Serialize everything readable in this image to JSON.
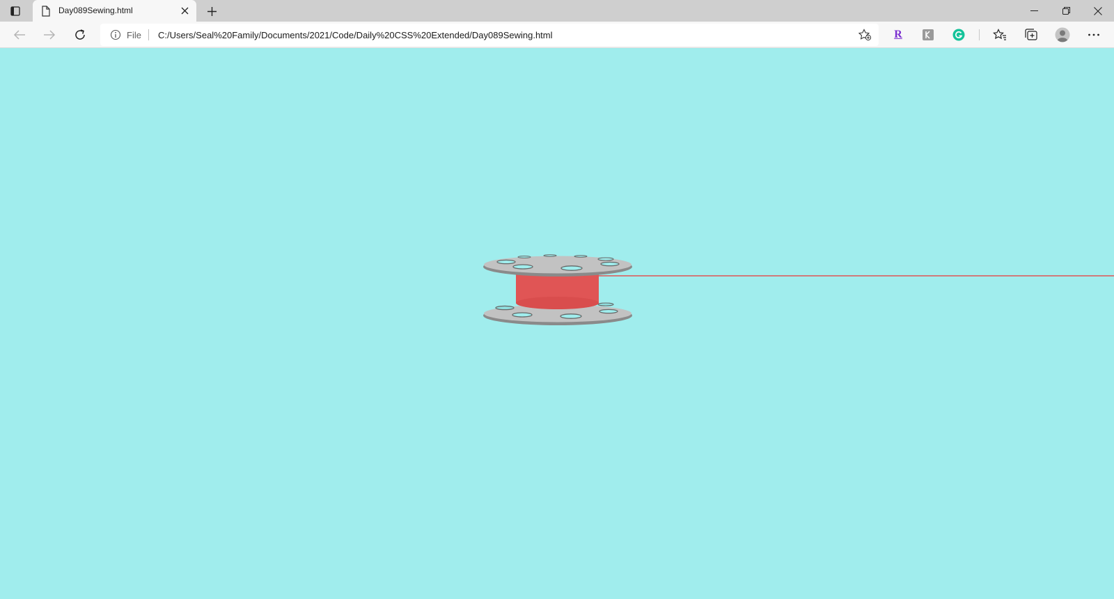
{
  "browser": {
    "tab": {
      "title": "Day089Sewing.html"
    },
    "address": {
      "scheme_label": "File",
      "url": "C:/Users/Seal%20Family/Documents/2021/Code/Daily%20CSS%20Extended/Day089Sewing.html"
    },
    "extensions": [
      {
        "icon": "r-extension-icon",
        "glyph": "R",
        "color": "#7b2fd0"
      },
      {
        "icon": "reader-extension-icon",
        "glyph": "",
        "color": "#9a9a9a"
      },
      {
        "icon": "grammarly-icon",
        "glyph": "G",
        "color": "#15c39a"
      }
    ]
  },
  "page": {
    "background": "#a0eded",
    "spool_color": "#e05555",
    "disc_color": "#c0c0c0",
    "thread_color": "#e05555"
  }
}
